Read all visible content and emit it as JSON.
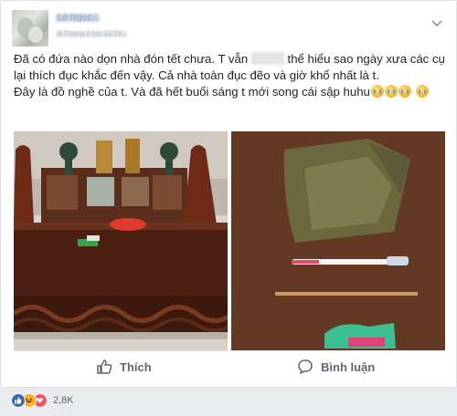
{
  "post": {
    "author_name": "Lê Ngọc",
    "meta": "8 Tháng 2 lúc 22:16",
    "line1_before": "Đã có đứa nào dọn nhà đón tết chưa. T vẫn",
    "line1_after": "thể hiểu sao ngày xưa các cụ lại thích đục khắc đến vậy. Cả nhà toàn đục đẽo và giờ khổ nhất là t.",
    "line2": "Đây là đồ nghề của t. Và đã hết buổi sáng t mới song cái sập huhu"
  },
  "actions": {
    "like_label": "Thích",
    "comment_label": "Bình luận"
  },
  "reactions": {
    "count": "2,8K",
    "types": [
      "like",
      "haha",
      "love"
    ]
  },
  "colors": {
    "link_blue": "#4267b2",
    "text": "#1d2129",
    "muted": "#606770"
  },
  "icons": [
    "chevron-down-icon",
    "thumbs-up-icon",
    "comment-bubble-icon",
    "like-reaction-icon",
    "haha-reaction-icon",
    "love-reaction-icon",
    "crying-emoji-icon"
  ]
}
